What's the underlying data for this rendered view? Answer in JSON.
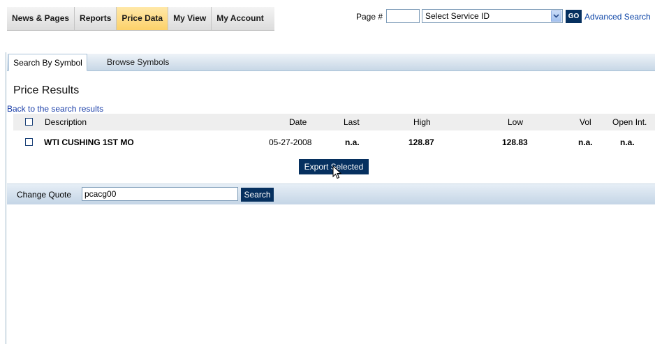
{
  "nav": {
    "tabs": [
      {
        "label": "News & Pages"
      },
      {
        "label": "Reports"
      },
      {
        "label": "Price Data"
      },
      {
        "label": "My View"
      },
      {
        "label": "My Account"
      }
    ],
    "active": "Price Data"
  },
  "pagebar": {
    "page_label": "Page #",
    "page_value": "",
    "service_select": "Select Service ID",
    "go_label": "GO",
    "advanced_search": "Advanced Search"
  },
  "subtabs": {
    "active": "Search By Symbol",
    "inactive": "Browse Symbols"
  },
  "results": {
    "title": "Price Results",
    "back_link": "Back to the search results",
    "columns": {
      "description": "Description",
      "date": "Date",
      "last": "Last",
      "high": "High",
      "low": "Low",
      "vol": "Vol",
      "open_int": "Open Int."
    },
    "rows": [
      {
        "description": "WTI CUSHING 1ST MO",
        "date": "05-27-2008",
        "last": "n.a.",
        "high": "128.87",
        "low": "128.83",
        "vol": "n.a.",
        "open_int": "n.a."
      }
    ],
    "export_label": "Export Selected"
  },
  "quote": {
    "label": "Change Quote",
    "value": "pcacg00",
    "search_label": "Search"
  },
  "colors": {
    "button_bg": "#06305f",
    "active_tab": "#fcd16a",
    "link": "#1a3ea8"
  }
}
